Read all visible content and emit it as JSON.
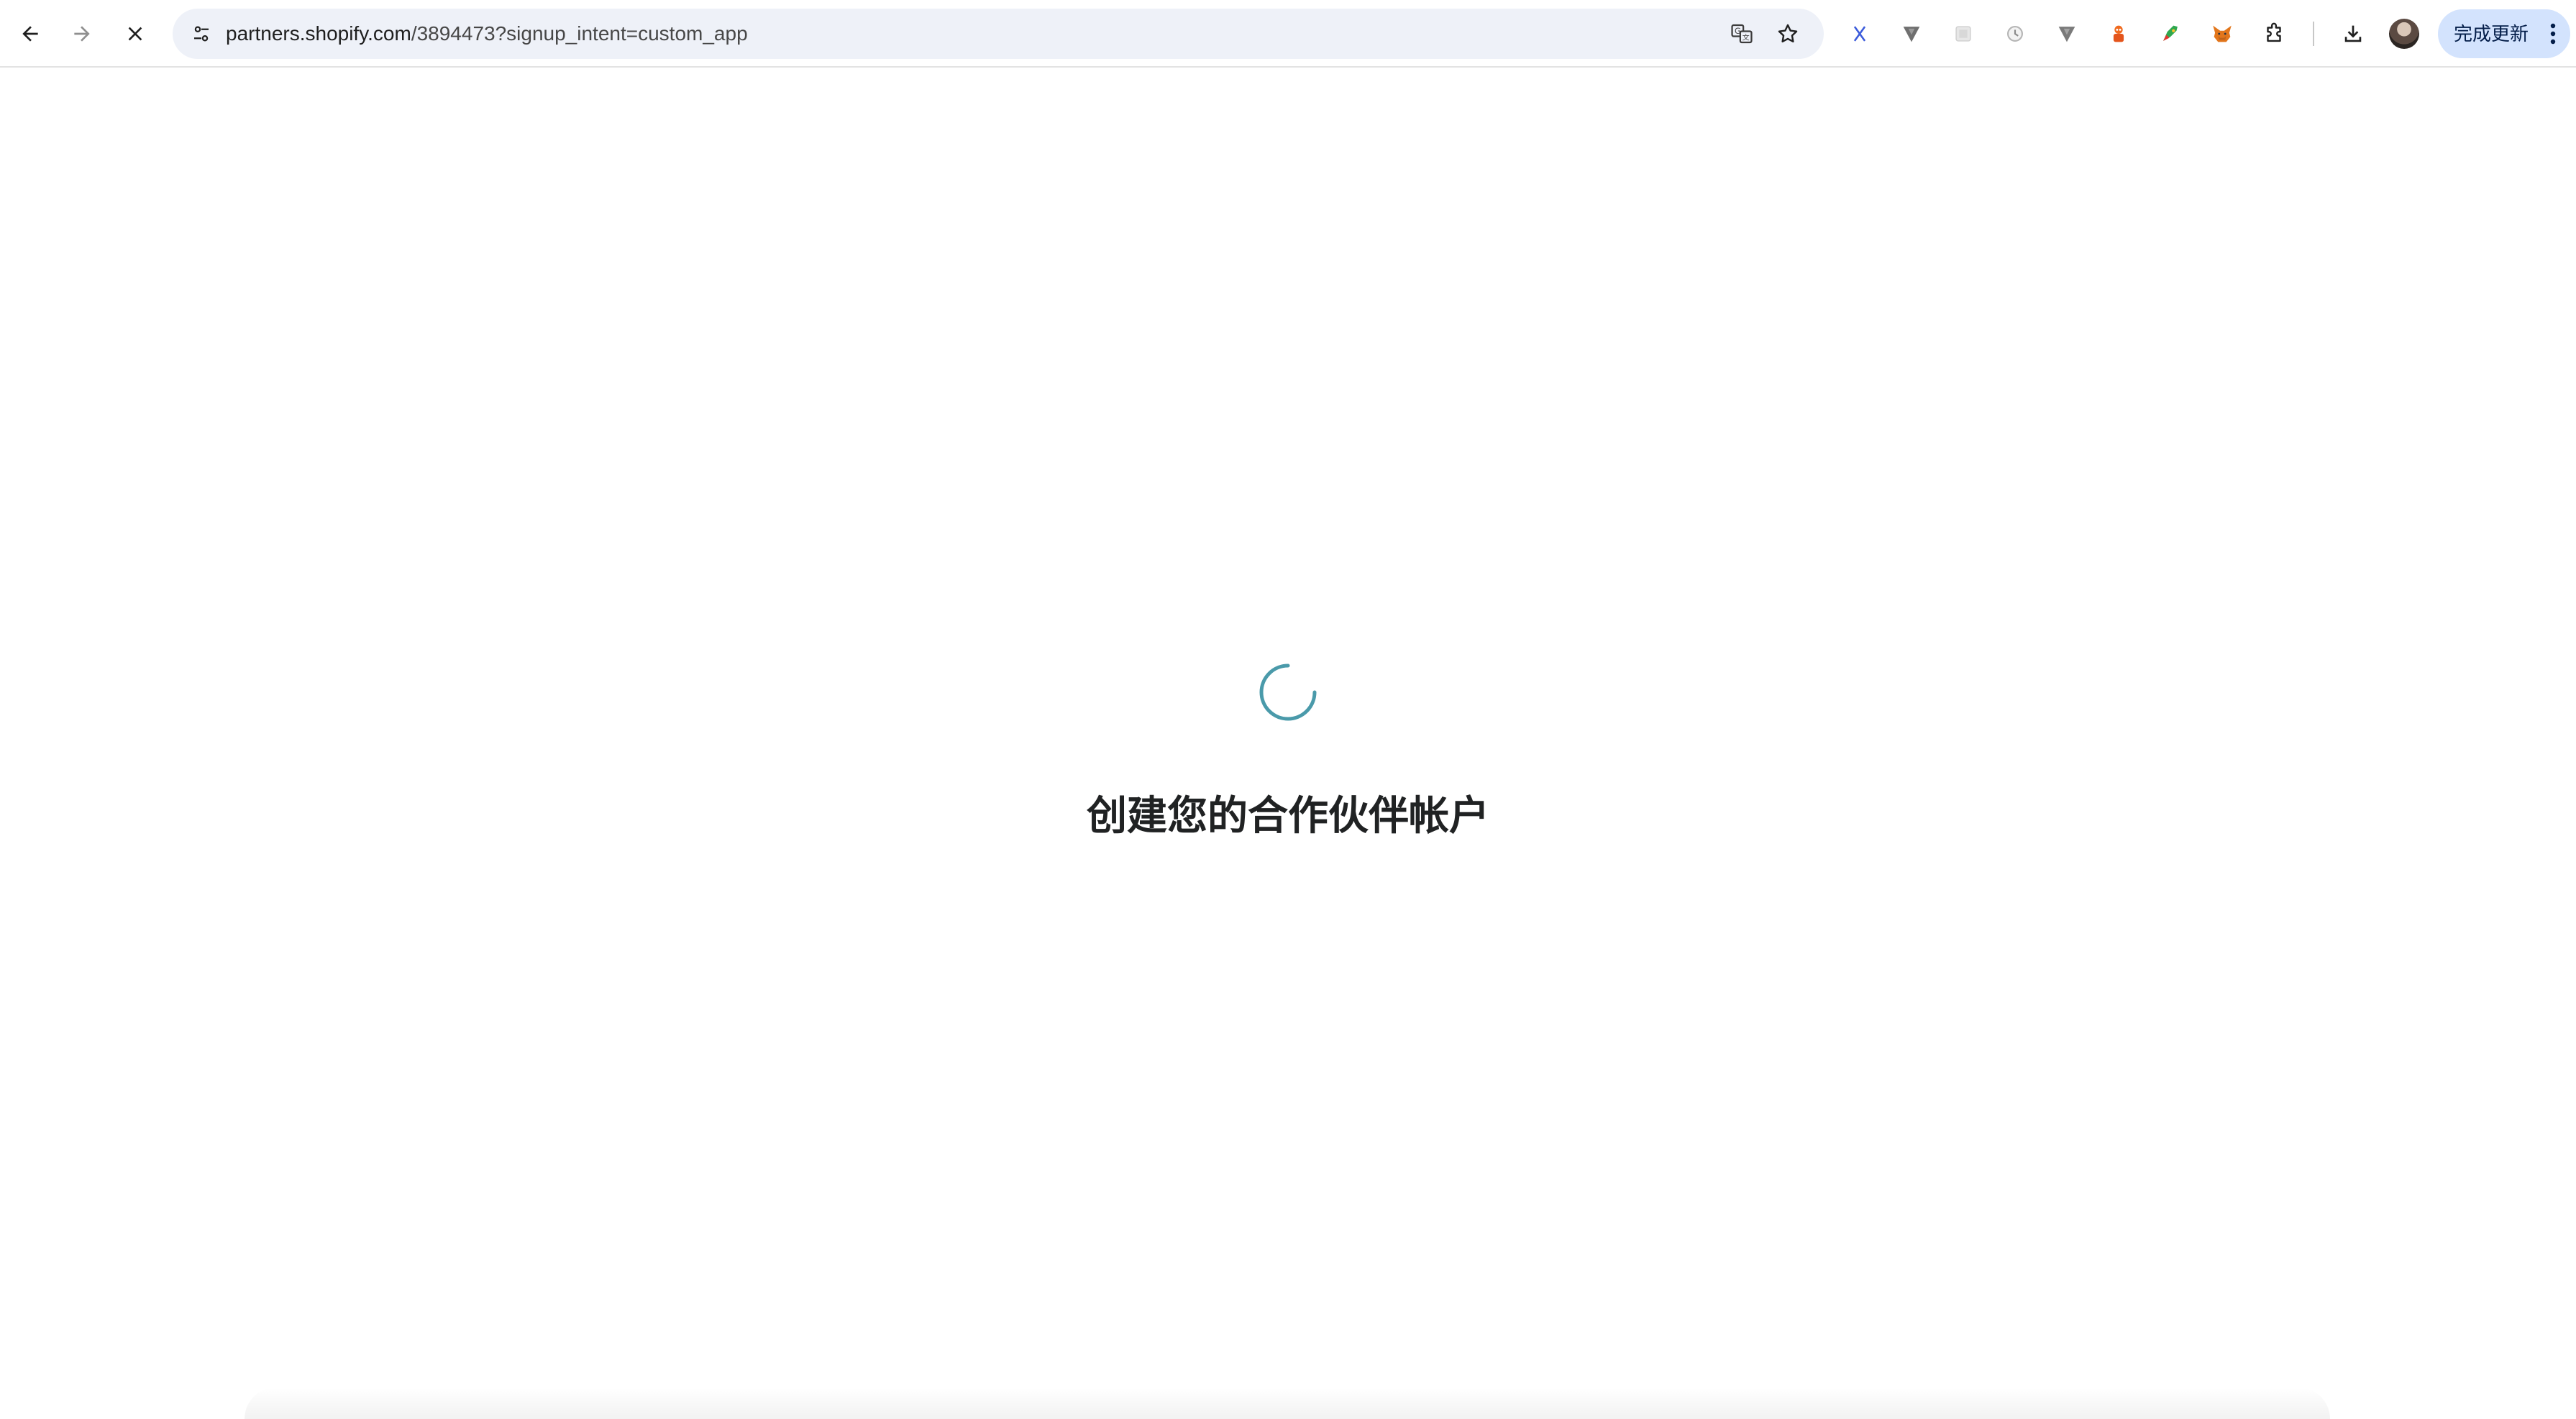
{
  "browser": {
    "url_host": "partners.shopify.com",
    "url_path": "/3894473?signup_intent=custom_app",
    "update_button_label": "完成更新",
    "icons": {
      "back": "arrow-left-icon",
      "forward": "arrow-right-icon",
      "stop": "close-icon",
      "site_info": "tune-icon",
      "translate": "translate-icon",
      "bookmark": "star-icon",
      "extensions": "puzzle-icon",
      "downloads": "download-icon",
      "menu": "more-vert-icon"
    },
    "accent_color": "#d3e3fd"
  },
  "page": {
    "title": "创建您的合作伙伴帐户",
    "spinner_color": "#4a9aaa"
  }
}
